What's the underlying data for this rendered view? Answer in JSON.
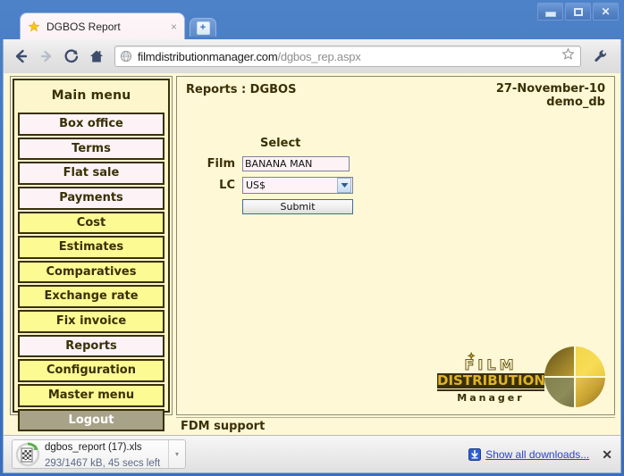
{
  "window": {
    "minimize_label": "Minimize",
    "maximize_label": "Maximize",
    "close_label": "Close"
  },
  "tab": {
    "title": "DGBOS Report",
    "close_label": "×",
    "favicon": "star-icon",
    "newtab_label": "+"
  },
  "toolbar": {
    "back_icon": "back-arrow-icon",
    "forward_icon": "forward-arrow-icon",
    "reload_icon": "reload-icon",
    "home_icon": "home-icon",
    "star_icon": "bookmark-star-icon",
    "wrench_icon": "wrench-icon",
    "url_domain": "filmdistributionmanager.com",
    "url_path": "/dgbos_rep.aspx"
  },
  "sidebar": {
    "title": "Main menu",
    "items": [
      {
        "label": "Box office",
        "style": "white"
      },
      {
        "label": "Terms",
        "style": "white"
      },
      {
        "label": "Flat sale",
        "style": "white"
      },
      {
        "label": "Payments",
        "style": "white"
      },
      {
        "label": "Cost",
        "style": "yellow"
      },
      {
        "label": "Estimates",
        "style": "yellow"
      },
      {
        "label": "Comparatives",
        "style": "yellow"
      },
      {
        "label": "Exchange rate",
        "style": "yellow"
      },
      {
        "label": "Fix invoice",
        "style": "yellow"
      },
      {
        "label": "Reports",
        "style": "white"
      },
      {
        "label": "Configuration",
        "style": "yellow"
      },
      {
        "label": "Master menu",
        "style": "yellow"
      },
      {
        "label": "Logout",
        "style": "logout"
      }
    ]
  },
  "main": {
    "report_title": "Reports : DGBOS",
    "date": "27-November-10",
    "database": "demo_db",
    "form": {
      "select_heading": "Select",
      "film_label": "Film",
      "film_value": "BANANA MAN",
      "lc_label": "LC",
      "lc_value": "US$",
      "submit_label": "Submit"
    },
    "logo": {
      "line1": "FILM",
      "line2": "DISTRIBUTION",
      "line3": "Manager"
    }
  },
  "footer": {
    "support_text": "FDM support"
  },
  "downloads": {
    "file_name": "dgbos_report (17).xls",
    "status": "293/1467 kB, 45 secs left",
    "caret_label": "▾",
    "show_all_label": "Show all downloads...",
    "close_label": "✕"
  },
  "colors": {
    "page_background": "#FFF8D6",
    "menu_yellow": "#FCFB93",
    "menu_white": "#FDF3F7",
    "logout_gray": "#A7A288",
    "border_dark": "#3A3005",
    "link_blue": "#2B44C8",
    "chrome_blue": "#3A6EBB"
  }
}
